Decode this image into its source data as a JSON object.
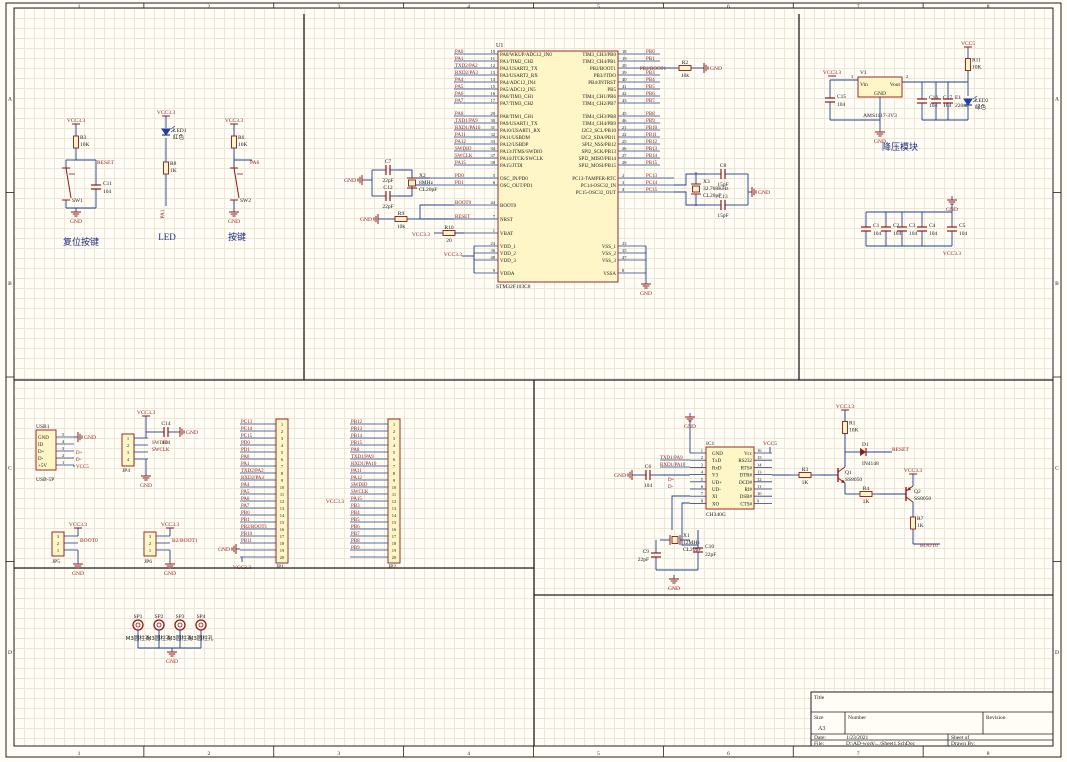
{
  "border": {
    "columns": [
      "1",
      "2",
      "3",
      "4",
      "5",
      "6",
      "7",
      "8"
    ],
    "rows": [
      "A",
      "B",
      "C",
      "D"
    ]
  },
  "labels": {
    "reset_caption": "复位按键",
    "led_caption": "LED",
    "key_caption": "按键",
    "regulator_caption": "降压模块",
    "hole_label": "M3圆柱孔"
  },
  "mcu": {
    "ref": "U1",
    "part": "STM32F103C8",
    "left_pins": [
      {
        "net": "PA0",
        "num": "10",
        "fn": "PA0/WKUP/ADC12_IN0"
      },
      {
        "net": "PA1",
        "num": "11",
        "fn": "PA1/TIM2_CH2"
      },
      {
        "net": "TXD2/PA2",
        "num": "12",
        "fn": "PA2/USART2_TX"
      },
      {
        "net": "RXD2/PA3",
        "num": "13",
        "fn": "PA3/USART2_RX"
      },
      {
        "net": "PA4",
        "num": "14",
        "fn": "PA4/ADC12_IN4"
      },
      {
        "net": "PA5",
        "num": "15",
        "fn": "PA5/ADC12_IN5"
      },
      {
        "net": "PA6",
        "num": "16",
        "fn": "PA6/TIM3_CH1"
      },
      {
        "net": "PA7",
        "num": "17",
        "fn": "PA7/TIM3_CH2"
      },
      {
        "net": "PA8",
        "num": "29",
        "fn": "PA8/TIM1_CH1"
      },
      {
        "net": "TXD1/PA9",
        "num": "30",
        "fn": "PA9/USART1_TX"
      },
      {
        "net": "RXD1/PA10",
        "num": "31",
        "fn": "PA10/USART1_RX"
      },
      {
        "net": "PA11",
        "num": "32",
        "fn": "PA11/USBDM"
      },
      {
        "net": "PA12",
        "num": "33",
        "fn": "PA12/USBDP"
      },
      {
        "net": "SWDIO",
        "num": "34",
        "fn": "PA13/JTMS/SWDIO"
      },
      {
        "net": "SWCLK",
        "num": "37",
        "fn": "PA14/JTCK/SWCLK"
      },
      {
        "net": "PA15",
        "num": "38",
        "fn": "PA15/JTDI"
      }
    ],
    "right_pins": [
      {
        "net": "PB0",
        "num": "18",
        "fn": "TIM3_CH3/PB0"
      },
      {
        "net": "PB1",
        "num": "19",
        "fn": "TIM3_CH4/PB1"
      },
      {
        "net": "PB2/BOOT1",
        "num": "20",
        "fn": "PB2/BOOT1"
      },
      {
        "net": "PB3",
        "num": "39",
        "fn": "PB3/JTDO"
      },
      {
        "net": "PB4",
        "num": "40",
        "fn": "PB4/JNTRST"
      },
      {
        "net": "PB5",
        "num": "41",
        "fn": "PB5"
      },
      {
        "net": "PB6",
        "num": "42",
        "fn": "TIM4_CH1/PB6"
      },
      {
        "net": "PB7",
        "num": "43",
        "fn": "TIM4_CH2/PB7"
      },
      {
        "net": "PB8",
        "num": "45",
        "fn": "TIM4_CH3/PB8"
      },
      {
        "net": "PB9",
        "num": "46",
        "fn": "TIM4_CH4/PB9"
      },
      {
        "net": "PB10",
        "num": "21",
        "fn": "I2C2_SCL/PB10"
      },
      {
        "net": "PB11",
        "num": "22",
        "fn": "I2C2_SDA/PB11"
      },
      {
        "net": "PB12",
        "num": "25",
        "fn": "SPI2_NSS/PB12"
      },
      {
        "net": "PB13",
        "num": "26",
        "fn": "SPI2_SCK/PB13"
      },
      {
        "net": "PB14",
        "num": "27",
        "fn": "SPI2_MISO/PB14"
      },
      {
        "net": "PB15",
        "num": "28",
        "fn": "SPI2_MOSI/PB15"
      }
    ],
    "osc_pins": [
      {
        "net": "PD0",
        "num": "5",
        "fn": "OSC_IN/PD0"
      },
      {
        "net": "PD1",
        "num": "6",
        "fn": "OSC_OUT/PD1"
      }
    ],
    "rtc_pins": [
      {
        "net": "PC13",
        "num": "2",
        "fn": "PC13-TAMPER-RTC"
      },
      {
        "net": "PC14",
        "num": "3",
        "fn": "PC14-OSC32_IN"
      },
      {
        "net": "PC15",
        "num": "4",
        "fn": "PC15-OSC32_OUT"
      }
    ],
    "misc_pins": [
      {
        "net": "BOOT0",
        "num": "44",
        "fn": "BOOT0"
      },
      {
        "net": "RESET",
        "num": "7",
        "fn": "NRST"
      },
      {
        "net": "",
        "num": "1",
        "fn": "VBAT"
      }
    ],
    "vdd_pins": [
      {
        "num": "24",
        "fn": "VDD_1"
      },
      {
        "num": "36",
        "fn": "VDD_2"
      },
      {
        "num": "48",
        "fn": "VDD_3"
      },
      {
        "num": "9",
        "fn": "VDDA"
      }
    ],
    "vss_pins": [
      {
        "num": "23",
        "fn": "VSS_1"
      },
      {
        "num": "35",
        "fn": "VSS_2"
      },
      {
        "num": "47",
        "fn": "VSS_3"
      },
      {
        "num": "8",
        "fn": "VSSA"
      }
    ]
  },
  "parts": {
    "r2": {
      "ref": "R2",
      "value": "10k"
    },
    "r9": {
      "ref": "R9",
      "value": "10k"
    },
    "r10": {
      "ref": "R10",
      "value": "20"
    },
    "r3a": {
      "ref": "R3",
      "value": "10K"
    },
    "r8": {
      "ref": "R8",
      "value": "1K"
    },
    "r6": {
      "ref": "R6",
      "value": "10K"
    },
    "r11": {
      "ref": "R11",
      "value": "10K"
    },
    "r1": {
      "ref": "R1",
      "value": "10K"
    },
    "r3b": {
      "ref": "R3",
      "value": "1K"
    },
    "r4": {
      "ref": "R4",
      "value": "1K"
    },
    "r7": {
      "ref": "R7",
      "value": "1K"
    },
    "c7": {
      "ref": "C7",
      "value": "22pF"
    },
    "c12": {
      "ref": "C12",
      "value": "22pF"
    },
    "c8": {
      "ref": "C8",
      "value": "15pF"
    },
    "c13": {
      "ref": "C13",
      "value": "15pF"
    },
    "c11": {
      "ref": "C11",
      "value": "104"
    },
    "c15": {
      "ref": "C15",
      "value": "104"
    },
    "c16": {
      "ref": "C16",
      "value": "104"
    },
    "c17": {
      "ref": "C17",
      "value": "104"
    },
    "e1": {
      "ref": "E1",
      "value": "220uF"
    },
    "c1": {
      "ref": "C1",
      "value": "104"
    },
    "c2": {
      "ref": "C2",
      "value": "104"
    },
    "c3": {
      "ref": "C3",
      "value": "104"
    },
    "c4": {
      "ref": "C4",
      "value": "104"
    },
    "c5": {
      "ref": "C5",
      "value": "104"
    },
    "c14": {
      "ref": "C14",
      "value": "104"
    },
    "c6": {
      "ref": "C6",
      "value": "104"
    },
    "c9": {
      "ref": "C9",
      "value": "22pF"
    },
    "c10": {
      "ref": "C10",
      "value": "22pF"
    },
    "x2": {
      "ref": "X2",
      "value": "8MHz",
      "sub": "CL20pF"
    },
    "x3": {
      "ref": "X3",
      "value": "32.768KHz",
      "sub": "CL20pF"
    },
    "x1": {
      "ref": "X1",
      "value": "12MHz",
      "sub": "CL20pF"
    },
    "sw1": {
      "ref": "SW1"
    },
    "sw2": {
      "ref": "SW2"
    },
    "led1": {
      "ref": "LED1",
      "value": "红色"
    },
    "led2": {
      "ref": "LED2",
      "value": "绿色"
    },
    "d1": {
      "ref": "D1",
      "value": "IN4148"
    },
    "q1": {
      "ref": "Q1",
      "value": "SS8050"
    },
    "q2": {
      "ref": "Q2",
      "value": "SS8050"
    },
    "v1": {
      "ref": "V1",
      "value": "AMS1117-3V3",
      "vin": "Vin",
      "vout": "Vout",
      "gnd": "GND"
    }
  },
  "nets": {
    "vcc33": "VCC3.3",
    "vcc5": "VCC5",
    "gnd": "GND",
    "reset": "RESET",
    "boot0": "BOOT0",
    "pa6": "PA6",
    "pa1": "PA1",
    "b2boot1": "B2/BOOT1",
    "swdio": "SWDIO",
    "swclk": "SWCLK",
    "txd1": "TXD1/PA9",
    "rxd1": "RXD1/PA10"
  },
  "usb": {
    "ref": "USB1",
    "part": "USB-5P",
    "pins": [
      {
        "num": "5",
        "name": "GND"
      },
      {
        "num": "4",
        "name": "ID"
      },
      {
        "num": "3",
        "name": "D+"
      },
      {
        "num": "2",
        "name": "D-"
      },
      {
        "num": "1",
        "name": "+5V"
      }
    ],
    "nets": [
      "",
      "",
      "D+",
      "D-"
    ]
  },
  "jp4": {
    "ref": "JP4",
    "pins": [
      "1",
      "2",
      "3",
      "4"
    ]
  },
  "jp5": {
    "ref": "JP5",
    "pins": [
      "3",
      "2",
      "1"
    ]
  },
  "jp6": {
    "ref": "JP6",
    "pins": [
      "3",
      "2",
      "1"
    ]
  },
  "jp1": {
    "ref": "JP1",
    "nets": [
      "PC13",
      "PC14",
      "PC15",
      "PD0",
      "PD1",
      "PA0",
      "PA1",
      "TXD2/PA2",
      "RXD2/PA3",
      "PA4",
      "PA5",
      "PA6",
      "PA7",
      "PB0",
      "PB1",
      "PB2/BOOT1",
      "PB10",
      "PB11",
      "",
      ""
    ],
    "pins": [
      "1",
      "2",
      "3",
      "4",
      "5",
      "6",
      "7",
      "8",
      "9",
      "10",
      "11",
      "12",
      "13",
      "14",
      "15",
      "16",
      "17",
      "18",
      "19",
      "20"
    ]
  },
  "jp2": {
    "ref": "JP2",
    "nets": [
      "PB12",
      "PB13",
      "PB14",
      "PB15",
      "PA8",
      "TXD1/PA9",
      "RXD1/PA10",
      "PA11",
      "PA12",
      "SWDIO",
      "SWCLK",
      "PA15",
      "PB3",
      "PB4",
      "PB5",
      "PB6",
      "PB7",
      "PB8",
      "PB9",
      ""
    ],
    "pins": [
      "1",
      "2",
      "3",
      "4",
      "5",
      "6",
      "7",
      "8",
      "9",
      "10",
      "11",
      "12",
      "13",
      "14",
      "15",
      "16",
      "17",
      "18",
      "19",
      "20"
    ]
  },
  "ch340": {
    "ref": "IC1",
    "part": "CH340G",
    "left": [
      {
        "num": "1",
        "name": "GND"
      },
      {
        "num": "2",
        "name": "TxD"
      },
      {
        "num": "3",
        "name": "RxD"
      },
      {
        "num": "4",
        "name": "V3"
      },
      {
        "num": "5",
        "name": "UD+"
      },
      {
        "num": "6",
        "name": "UD-"
      },
      {
        "num": "7",
        "name": "XI"
      },
      {
        "num": "8",
        "name": "XO"
      }
    ],
    "right": [
      {
        "num": "16",
        "name": "Vcc"
      },
      {
        "num": "15",
        "name": "RS232"
      },
      {
        "num": "14",
        "name": "RTS#"
      },
      {
        "num": "13",
        "name": "DTR#"
      },
      {
        "num": "12",
        "name": "DCD#"
      },
      {
        "num": "11",
        "name": "RI#"
      },
      {
        "num": "10",
        "name": "DSR#"
      },
      {
        "num": "9",
        "name": "CTS#"
      }
    ]
  },
  "mounting_holes": [
    {
      "ref": "SP1",
      "label": "M3圆柱孔"
    },
    {
      "ref": "SP2",
      "label": "M3圆柱孔"
    },
    {
      "ref": "SP3",
      "label": "M3圆柱孔"
    },
    {
      "ref": "SP4",
      "label": "M3圆柱孔"
    }
  ],
  "title_block": {
    "title_label": "Title",
    "size_label": "Size",
    "size_value": "A3",
    "number_label": "Number",
    "revision_label": "Revision",
    "date_label": "Date:",
    "date_value": "1/23/2021",
    "sheet_label": "Sheet  of",
    "file_label": "File:",
    "file_value": "D:\\AD-work\\...\\Sheet1.SchDoc",
    "drawn_label": "Drawn By:"
  },
  "colors": {
    "wire": "#1f3f8f",
    "component": "#8b1a1a",
    "body": "#fff6c8",
    "net": "#8b1a1a",
    "frame": "#202020",
    "led": "#2040a0"
  }
}
